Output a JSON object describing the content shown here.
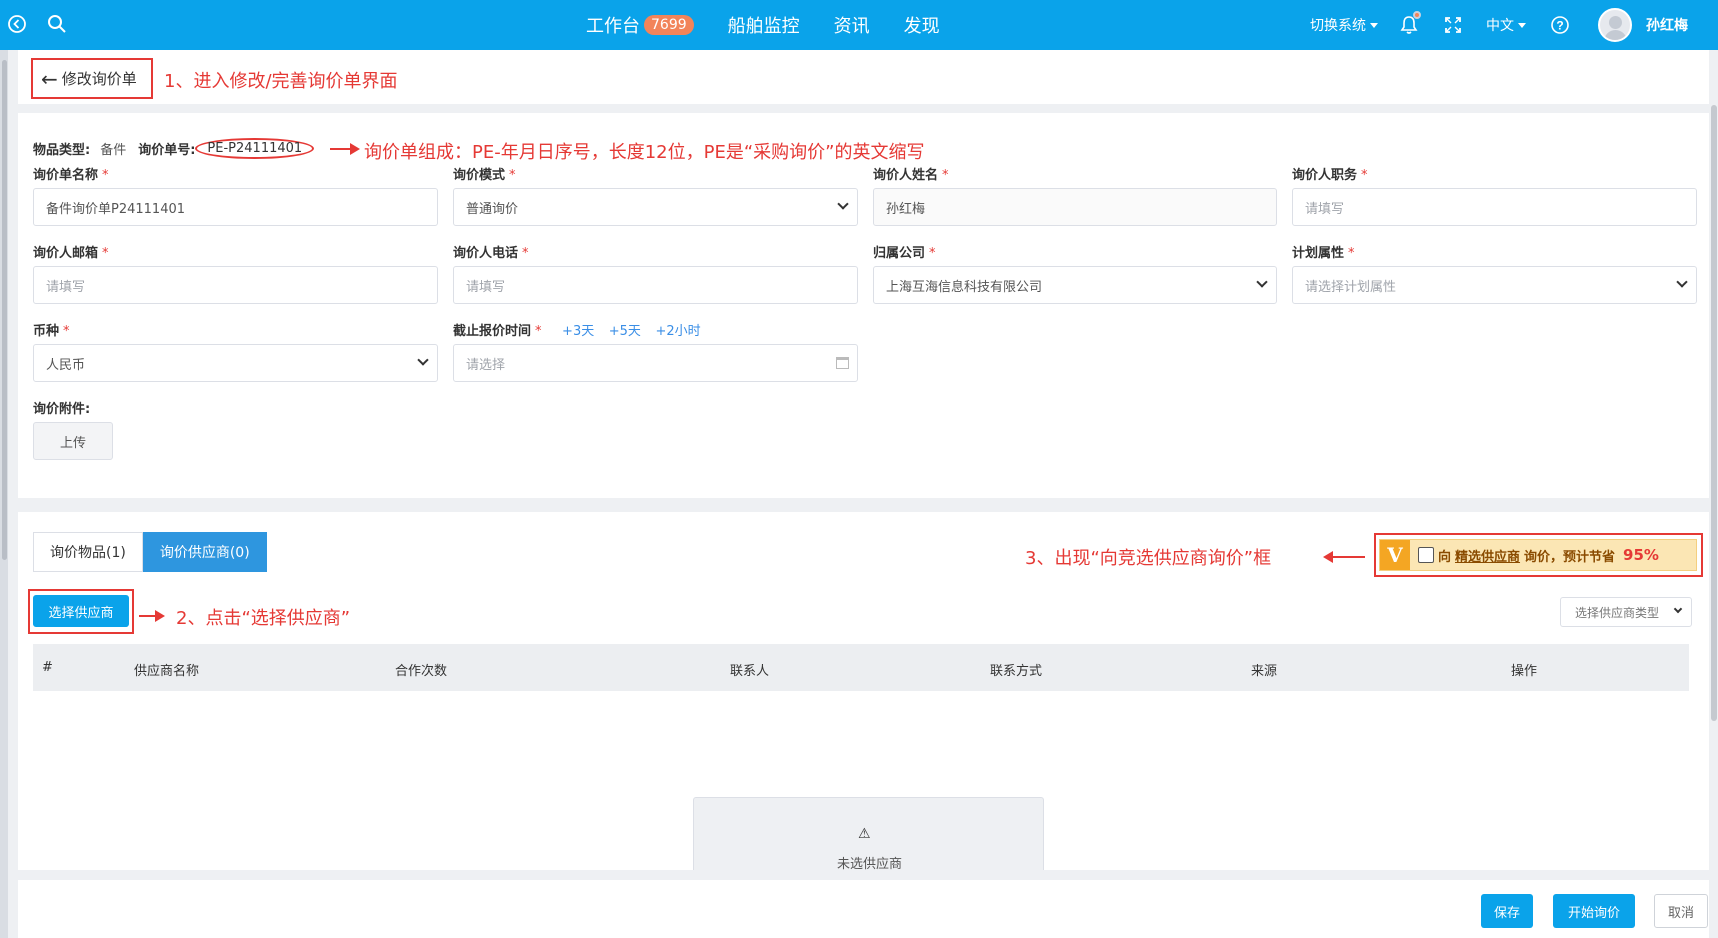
{
  "topbar": {
    "nav": [
      {
        "label": "工作台",
        "badge": "7699"
      },
      {
        "label": "船舶监控"
      },
      {
        "label": "资讯"
      },
      {
        "label": "发现"
      }
    ],
    "switch_system": "切换系统",
    "language": "中文",
    "user_name": "孙红梅",
    "icons": [
      "back-circle-icon",
      "search-icon",
      "bell-icon",
      "fullscreen-icon",
      "help-icon"
    ]
  },
  "header": {
    "back_label": "修改询价单",
    "note1": "1、进入修改/完善询价单界面"
  },
  "meta": {
    "type_label": "物品类型:",
    "type_value": "备件",
    "no_label": "询价单号:",
    "no_value": "PE-P24111401",
    "note": "询价单组成：PE-年月日序号，长度12位，PE是“采购询价”的英文缩写"
  },
  "form": {
    "fields": [
      {
        "label": "询价单名称",
        "value": "备件询价单P24111401"
      },
      {
        "label": "询价模式",
        "value": "普通询价"
      },
      {
        "label": "询价人姓名",
        "value": "孙红梅"
      },
      {
        "label": "询价人职务",
        "placeholder": "请填写"
      },
      {
        "label": "询价人邮箱",
        "placeholder": "请填写"
      },
      {
        "label": "询价人电话",
        "placeholder": "请填写"
      },
      {
        "label": "归属公司",
        "value": "上海互海信息科技有限公司"
      },
      {
        "label": "计划属性",
        "placeholder": "请选择计划属性"
      },
      {
        "label": "币种",
        "value": "人民币"
      },
      {
        "label": "截止报价时间",
        "placeholder": "请选择"
      }
    ],
    "required_mark": "*",
    "quick_times": [
      "+3天",
      "+5天",
      "+2小时"
    ],
    "attachment_label": "询价附件:",
    "upload_label": "上传"
  },
  "tabs": [
    {
      "label": "询价物品(1)",
      "active": false
    },
    {
      "label": "询价供应商(0)",
      "active": true
    }
  ],
  "supplier": {
    "select_button": "选择供应商",
    "note2": "2、点击“选择供应商”",
    "note3": "3、出现“向竞选供应商询价”框",
    "promo": {
      "prefix": "向",
      "link": "精选供应商",
      "suffix": "询价，预计节省",
      "percent": "95%",
      "badge": "V"
    },
    "type_placeholder": "选择供应商类型",
    "columns": [
      "#",
      "供应商名称",
      "合作次数",
      "联系人",
      "联系方式",
      "来源",
      "操作"
    ],
    "empty_text": "未选供应商",
    "empty_icon": "⚠"
  },
  "footer": {
    "save": "保存",
    "start": "开始询价",
    "cancel": "取消"
  },
  "colors": {
    "primary": "#0aa3ea",
    "annotation": "#e53935",
    "badge": "#f2845a"
  }
}
